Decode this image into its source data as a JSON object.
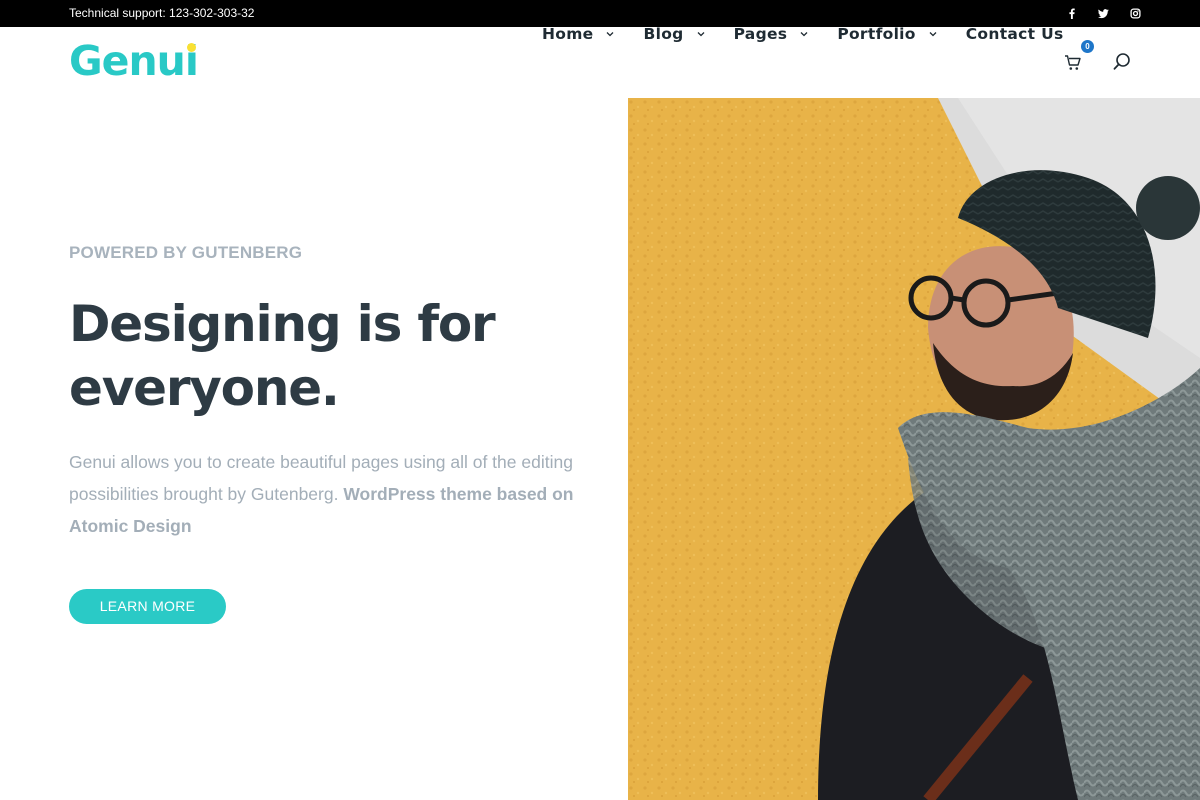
{
  "topbar": {
    "support": "Technical support: 123-302-303-32",
    "socials": [
      "facebook-icon",
      "twitter-icon",
      "instagram-icon"
    ]
  },
  "header": {
    "logo": {
      "main": "Genu",
      "last": "i"
    },
    "nav": [
      {
        "label": "Home",
        "dropdown": true
      },
      {
        "label": "Blog",
        "dropdown": true
      },
      {
        "label": "Pages",
        "dropdown": true
      },
      {
        "label": "Portfolio",
        "dropdown": true
      },
      {
        "label": "Contact Us",
        "dropdown": false
      }
    ],
    "cart_count": "0"
  },
  "hero": {
    "eyebrow": "POWERED BY GUTENBERG",
    "headline_line1": "Designing is for",
    "headline_line2": "everyone.",
    "desc_plain": "Genui allows you to create beautiful pages using all of the editing possibilities brought by Gutenberg. ",
    "desc_bold": "WordPress theme based on Atomic Design",
    "button": "LEARN MORE"
  },
  "colors": {
    "accent": "#2acac6",
    "logo_dot": "#f9e033",
    "badge": "#1e76c9",
    "heading": "#2e3b44",
    "muted": "#a3aeb8"
  }
}
